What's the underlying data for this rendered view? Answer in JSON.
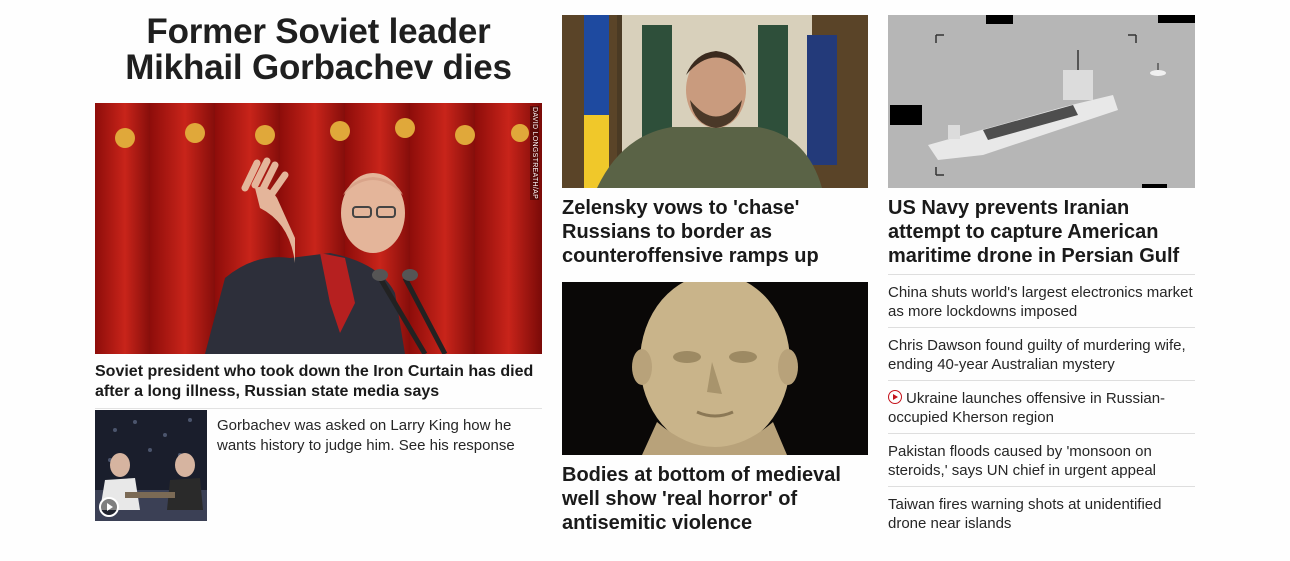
{
  "lead": {
    "headline": "Former Soviet leader Mikhail Gorbachev dies",
    "image_credit": "DAVID LONGSTREATH/AP",
    "subheadline": "Soviet president who took down the Iron Curtain has died after a long illness, Russian state media says",
    "video": {
      "text": "Gorbachev was asked on Larry King how he wants history to judge him. See his response",
      "icon": "play-icon"
    }
  },
  "middle": {
    "stories": [
      {
        "headline": "Zelensky vows to 'chase' Russians to border as counteroffensive ramps up"
      },
      {
        "headline": "Bodies at bottom of medieval well show 'real horror' of antisemitic violence"
      }
    ]
  },
  "right": {
    "feature": {
      "headline": "US Navy prevents Iranian attempt to capture American maritime drone in Persian Gulf"
    },
    "list": [
      {
        "text": "China shuts world's largest electronics market as more lockdowns imposed",
        "video": false
      },
      {
        "text": "Chris Dawson found guilty of murdering wife, ending 40-year Australian mystery",
        "video": false
      },
      {
        "text": "Ukraine launches offensive in Russian-occupied Kherson region",
        "video": true
      },
      {
        "text": "Pakistan floods caused by 'monsoon on steroids,' says UN chief in urgent appeal",
        "video": false
      },
      {
        "text": "Taiwan fires warning shots at unidentified drone near islands",
        "video": false
      }
    ]
  },
  "colors": {
    "accent_red": "#c4121a",
    "text": "#1a1a1a",
    "divider": "#dedede"
  }
}
